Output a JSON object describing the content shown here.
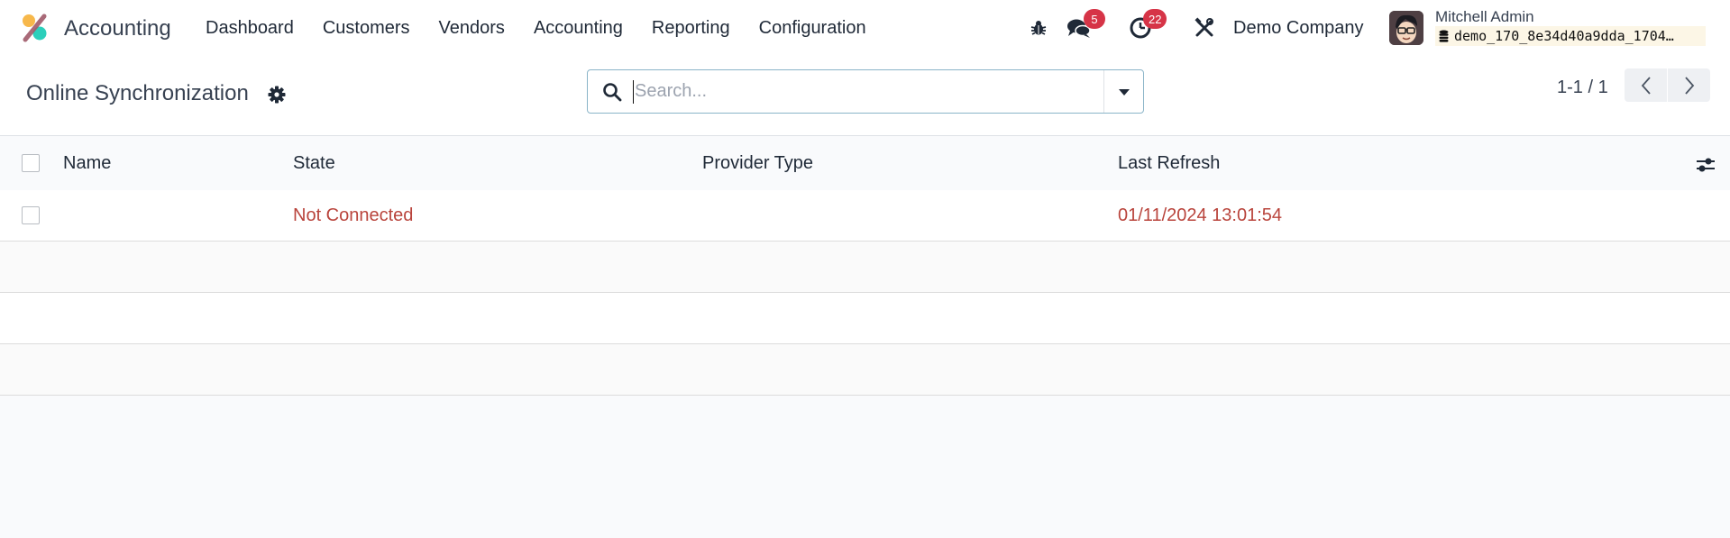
{
  "navbar": {
    "app_name": "Accounting",
    "menu": [
      {
        "label": "Dashboard"
      },
      {
        "label": "Customers"
      },
      {
        "label": "Vendors"
      },
      {
        "label": "Accounting"
      },
      {
        "label": "Reporting"
      },
      {
        "label": "Configuration"
      }
    ],
    "systray": {
      "debug_icon": "bug-icon",
      "messages_icon": "chat-bubbles-icon",
      "messages_count": "5",
      "activities_icon": "clock-icon",
      "activities_count": "22",
      "settings_icon": "tools-icon",
      "company": "Demo Company",
      "user_name": "Mitchell Admin",
      "database": "demo_170_8e34d40a9dda_1704…"
    },
    "badge_color": "#d63447"
  },
  "control_panel": {
    "title": "Online Synchronization",
    "search": {
      "placeholder": "Search...",
      "value": ""
    },
    "pager": {
      "value": "1-1 / 1"
    }
  },
  "list": {
    "columns": [
      "Name",
      "State",
      "Provider Type",
      "Last Refresh"
    ],
    "rows": [
      {
        "name": "",
        "state": "Not Connected",
        "provider_type": "",
        "last_refresh": "01/11/2024 13:01:54"
      }
    ],
    "state_color": "#b9443c"
  }
}
